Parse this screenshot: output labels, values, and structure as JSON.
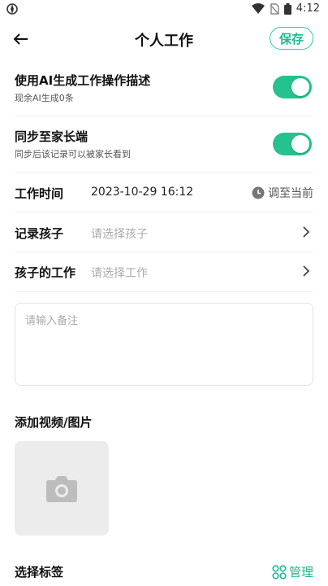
{
  "status_bar": {
    "time": "4:12"
  },
  "header": {
    "title": "个人工作",
    "save_label": "保存"
  },
  "ai_description": {
    "label": "使用AI生成工作操作描述",
    "sublabel": "现余AI生成0条",
    "enabled": true
  },
  "sync_parent": {
    "label": "同步至家长端",
    "sublabel": "同步后该记录可以被家长看到",
    "enabled": true
  },
  "work_time": {
    "label": "工作时间",
    "value": "2023-10-29 16:12",
    "set_now_label": "调至当前"
  },
  "record_child": {
    "label": "记录孩子",
    "placeholder": "请选择孩子"
  },
  "child_work": {
    "label": "孩子的工作",
    "placeholder": "请选择工作"
  },
  "notes": {
    "placeholder": "请输入备注"
  },
  "media": {
    "title": "添加视频/图片"
  },
  "tags": {
    "title": "选择标签",
    "manage_label": "管理"
  },
  "colors": {
    "accent": "#25c290",
    "accent_text": "#1fb98f"
  }
}
